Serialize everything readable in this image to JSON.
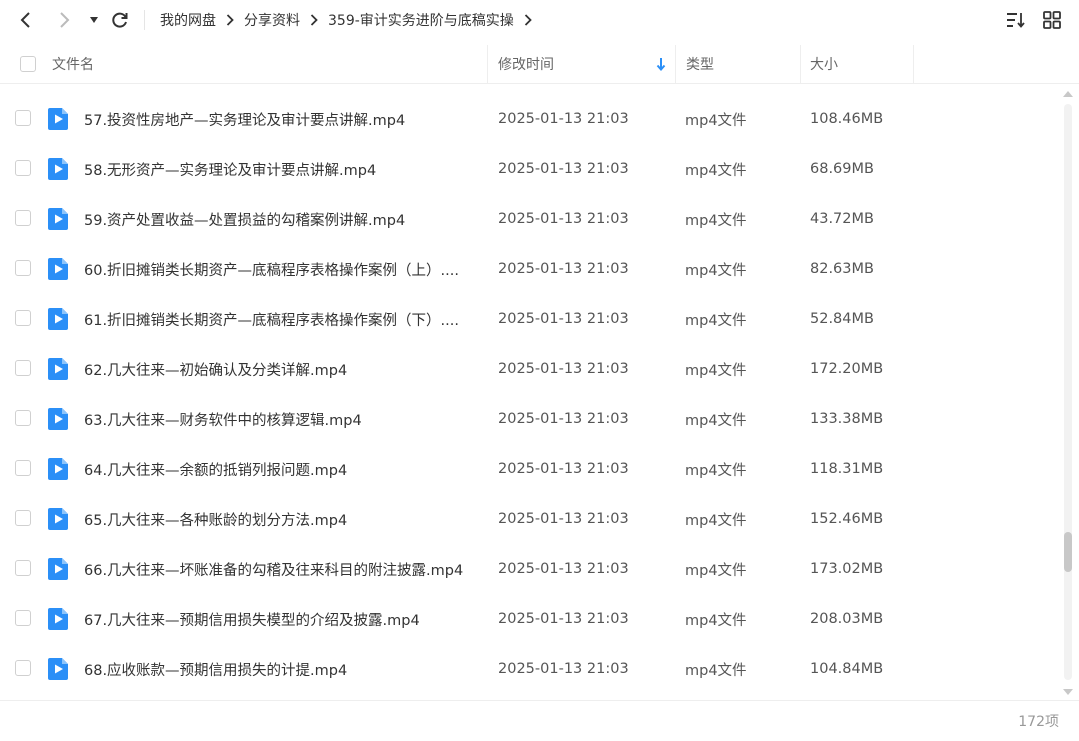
{
  "breadcrumb": [
    "我的网盘",
    "分享资料",
    "359-审计实务进阶与底稿实操"
  ],
  "columns": {
    "name": "文件名",
    "modified": "修改时间",
    "type": "类型",
    "size": "大小"
  },
  "files": [
    {
      "name": "57.投资性房地产—实务理论及审计要点讲解.mp4",
      "modified": "2025-01-13 21:03",
      "type": "mp4文件",
      "size": "108.46MB"
    },
    {
      "name": "58.无形资产—实务理论及审计要点讲解.mp4",
      "modified": "2025-01-13 21:03",
      "type": "mp4文件",
      "size": "68.69MB"
    },
    {
      "name": "59.资产处置收益—处置损益的勾稽案例讲解.mp4",
      "modified": "2025-01-13 21:03",
      "type": "mp4文件",
      "size": "43.72MB"
    },
    {
      "name": "60.折旧摊销类长期资产—底稿程序表格操作案例（上）....",
      "modified": "2025-01-13 21:03",
      "type": "mp4文件",
      "size": "82.63MB"
    },
    {
      "name": "61.折旧摊销类长期资产—底稿程序表格操作案例（下）....",
      "modified": "2025-01-13 21:03",
      "type": "mp4文件",
      "size": "52.84MB"
    },
    {
      "name": "62.几大往来—初始确认及分类详解.mp4",
      "modified": "2025-01-13 21:03",
      "type": "mp4文件",
      "size": "172.20MB"
    },
    {
      "name": "63.几大往来—财务软件中的核算逻辑.mp4",
      "modified": "2025-01-13 21:03",
      "type": "mp4文件",
      "size": "133.38MB"
    },
    {
      "name": "64.几大往来—余额的抵销列报问题.mp4",
      "modified": "2025-01-13 21:03",
      "type": "mp4文件",
      "size": "118.31MB"
    },
    {
      "name": "65.几大往来—各种账龄的划分方法.mp4",
      "modified": "2025-01-13 21:03",
      "type": "mp4文件",
      "size": "152.46MB"
    },
    {
      "name": "66.几大往来—坏账准备的勾稽及往来科目的附注披露.mp4",
      "modified": "2025-01-13 21:03",
      "type": "mp4文件",
      "size": "173.02MB"
    },
    {
      "name": "67.几大往来—预期信用损失模型的介绍及披露.mp4",
      "modified": "2025-01-13 21:03",
      "type": "mp4文件",
      "size": "208.03MB"
    },
    {
      "name": "68.应收账款—预期信用损失的计提.mp4",
      "modified": "2025-01-13 21:03",
      "type": "mp4文件",
      "size": "104.84MB"
    }
  ],
  "footer": {
    "count": "172项"
  },
  "colors": {
    "accent": "#2b8ff7",
    "file_icon": "#2b8ff7"
  }
}
